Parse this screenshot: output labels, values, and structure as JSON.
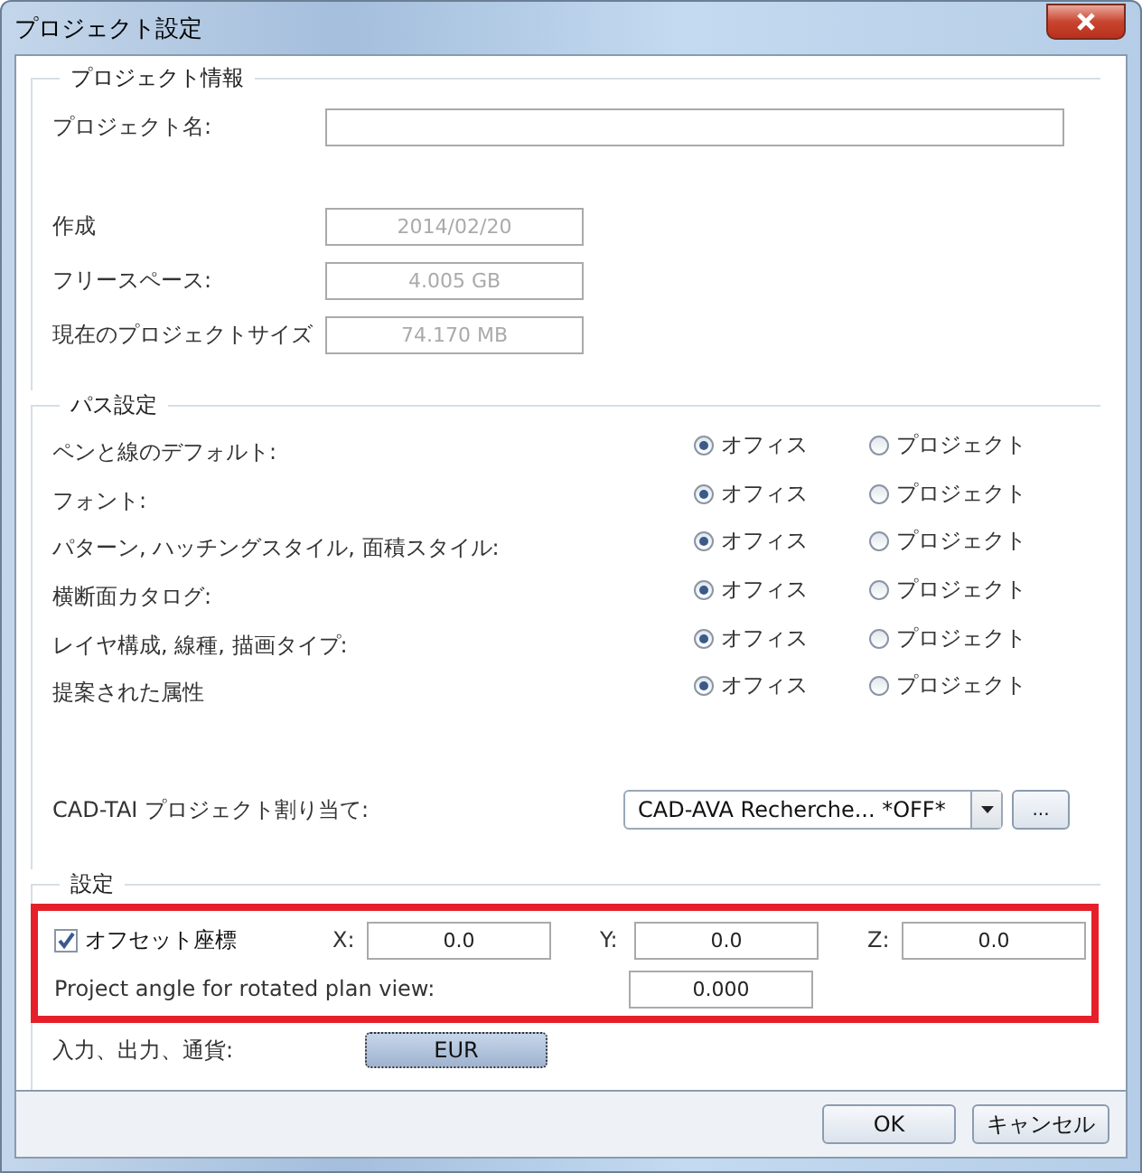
{
  "window": {
    "title": "プロジェクト設定"
  },
  "project_info": {
    "title": "プロジェクト情報",
    "name_label": "プロジェクト名:",
    "fields": [
      {
        "label": "作成",
        "value": "2014/02/20",
        "disabled": true
      },
      {
        "label": "フリースペース:",
        "value": "4.005 GB",
        "disabled": true
      },
      {
        "label": "現在のプロジェクトサイズ",
        "value": "74.170 MB",
        "disabled": true
      }
    ]
  },
  "path_settings": {
    "title": "パス設定",
    "rows": [
      {
        "label": "ペンと線のデフォルト:",
        "options": [
          {
            "label": "オフィス",
            "selected": true
          },
          {
            "label": "プロジェクト",
            "selected": false
          }
        ]
      },
      {
        "label": "フォント:",
        "options": [
          {
            "label": "オフィス",
            "selected": true
          },
          {
            "label": "プロジェクト",
            "selected": false
          }
        ]
      },
      {
        "label": "パターン, ハッチングスタイル, 面積スタイル:",
        "options": [
          {
            "label": "オフィス",
            "selected": true
          },
          {
            "label": "プロジェクト",
            "selected": false
          }
        ]
      },
      {
        "label": "横断面カタログ:",
        "options": [
          {
            "label": "オフィス",
            "selected": true
          },
          {
            "label": "プロジェクト",
            "selected": false
          }
        ]
      },
      {
        "label": "レイヤ構成, 線種, 描画タイプ:",
        "options": [
          {
            "label": "オフィス",
            "selected": true
          },
          {
            "label": "プロジェクト",
            "selected": false
          }
        ]
      },
      {
        "label": "提案された属性",
        "options": [
          {
            "label": "オフィス",
            "selected": true
          },
          {
            "label": "プロジェクト",
            "selected": false
          }
        ]
      }
    ]
  },
  "cad_tai": {
    "label": "CAD-TAI プロジェクト割り当て:",
    "value": "CAD-AVA Recherche... *OFF*",
    "browse_button": "..."
  },
  "settings": {
    "title": "設定",
    "offset": {
      "label": "オフセット座標",
      "checked": true,
      "coords": [
        {
          "label": "X:",
          "value": "0.0"
        },
        {
          "label": "Y:",
          "value": "0.0"
        },
        {
          "label": "Z:",
          "value": "0.0"
        }
      ]
    },
    "angle": {
      "label": "Project angle for rotated plan view:",
      "value": "0.000"
    },
    "currency": {
      "label": "入力、出力、通貨:",
      "button": "EUR"
    }
  },
  "buttons": [
    "OK",
    "キャンセル"
  ]
}
